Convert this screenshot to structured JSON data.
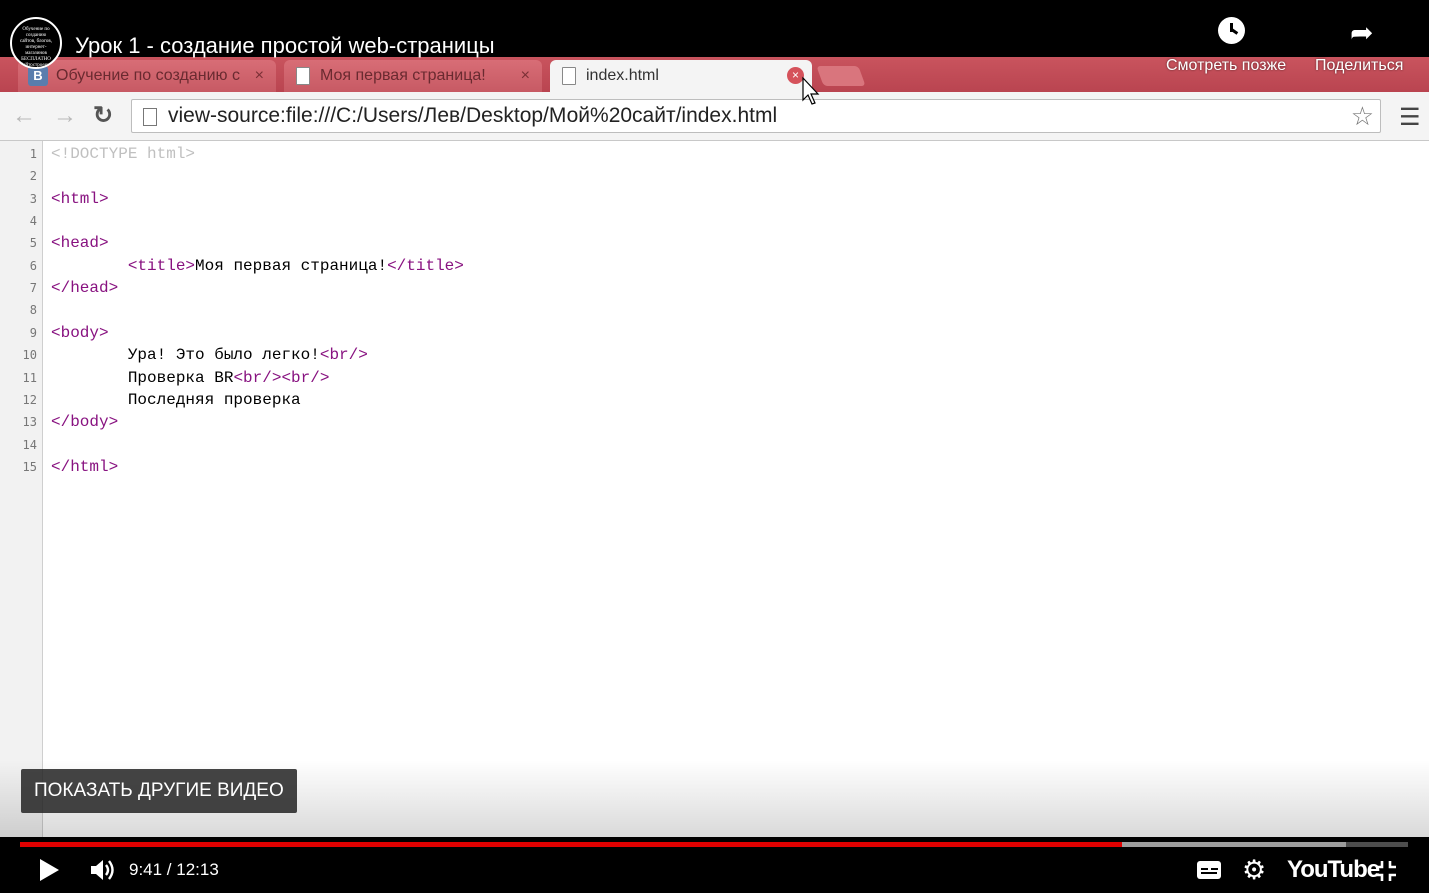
{
  "video": {
    "title": "Урок 1 - создание простой web-страницы",
    "channel_avatar_text": "Обучение по созданию сайтов, блогов, интернет-магазинов БЕСПЛАТНО Сайтостроение Web-программирование",
    "watch_later_label": "Смотреть позже",
    "share_label": "Поделиться",
    "show_more_videos_label": "ПОКАЗАТЬ ДРУГИЕ ВИДЕО",
    "current_time": "9:41",
    "duration": "12:13",
    "time_display": "9:41 / 12:13",
    "progress_fraction": 0.794,
    "buffered_fraction": 0.955,
    "brand": "YouTube",
    "accent_color": "#e00000"
  },
  "browser": {
    "tabs": [
      {
        "label": "Обучение по созданию с",
        "icon": "vk-icon",
        "favicon_text": "B",
        "close": "×"
      },
      {
        "label": "Моя первая страница!",
        "icon": "document-icon",
        "close": "×"
      },
      {
        "label": "index.html",
        "icon": "document-icon",
        "close": "×",
        "active": true
      }
    ],
    "address_bar": {
      "url": "view-source:file:///C:/Users/Лев/Desktop/Мой%20сайт/index.html"
    },
    "frame_color": "#c0505a"
  },
  "source": {
    "lines": [
      {
        "n": "1",
        "parts": [
          {
            "t": "<!DOCTYPE html>",
            "c": "doctype"
          }
        ]
      },
      {
        "n": "2",
        "parts": []
      },
      {
        "n": "3",
        "parts": [
          {
            "t": "<html>",
            "c": "tag"
          }
        ]
      },
      {
        "n": "4",
        "parts": []
      },
      {
        "n": "5",
        "parts": [
          {
            "t": "<head>",
            "c": "tag"
          }
        ]
      },
      {
        "n": "6",
        "parts": [
          {
            "t": "        ",
            "c": ""
          },
          {
            "t": "<title>",
            "c": "tag"
          },
          {
            "t": "Моя первая страница!",
            "c": ""
          },
          {
            "t": "</title>",
            "c": "tag"
          }
        ]
      },
      {
        "n": "7",
        "parts": [
          {
            "t": "</head>",
            "c": "tag"
          }
        ]
      },
      {
        "n": "8",
        "parts": []
      },
      {
        "n": "9",
        "parts": [
          {
            "t": "<body>",
            "c": "tag"
          }
        ]
      },
      {
        "n": "10",
        "parts": [
          {
            "t": "        ",
            "c": ""
          },
          {
            "t": "Ура! Это было легко!",
            "c": ""
          },
          {
            "t": "<br/>",
            "c": "tag"
          }
        ]
      },
      {
        "n": "11",
        "parts": [
          {
            "t": "        ",
            "c": ""
          },
          {
            "t": "Проверка BR",
            "c": ""
          },
          {
            "t": "<br/><br/>",
            "c": "tag"
          }
        ]
      },
      {
        "n": "12",
        "parts": [
          {
            "t": "        ",
            "c": ""
          },
          {
            "t": "Последняя проверка",
            "c": ""
          }
        ]
      },
      {
        "n": "13",
        "parts": [
          {
            "t": "</body>",
            "c": "tag"
          }
        ]
      },
      {
        "n": "14",
        "parts": []
      },
      {
        "n": "15",
        "parts": [
          {
            "t": "</html>",
            "c": "tag"
          }
        ]
      }
    ]
  }
}
